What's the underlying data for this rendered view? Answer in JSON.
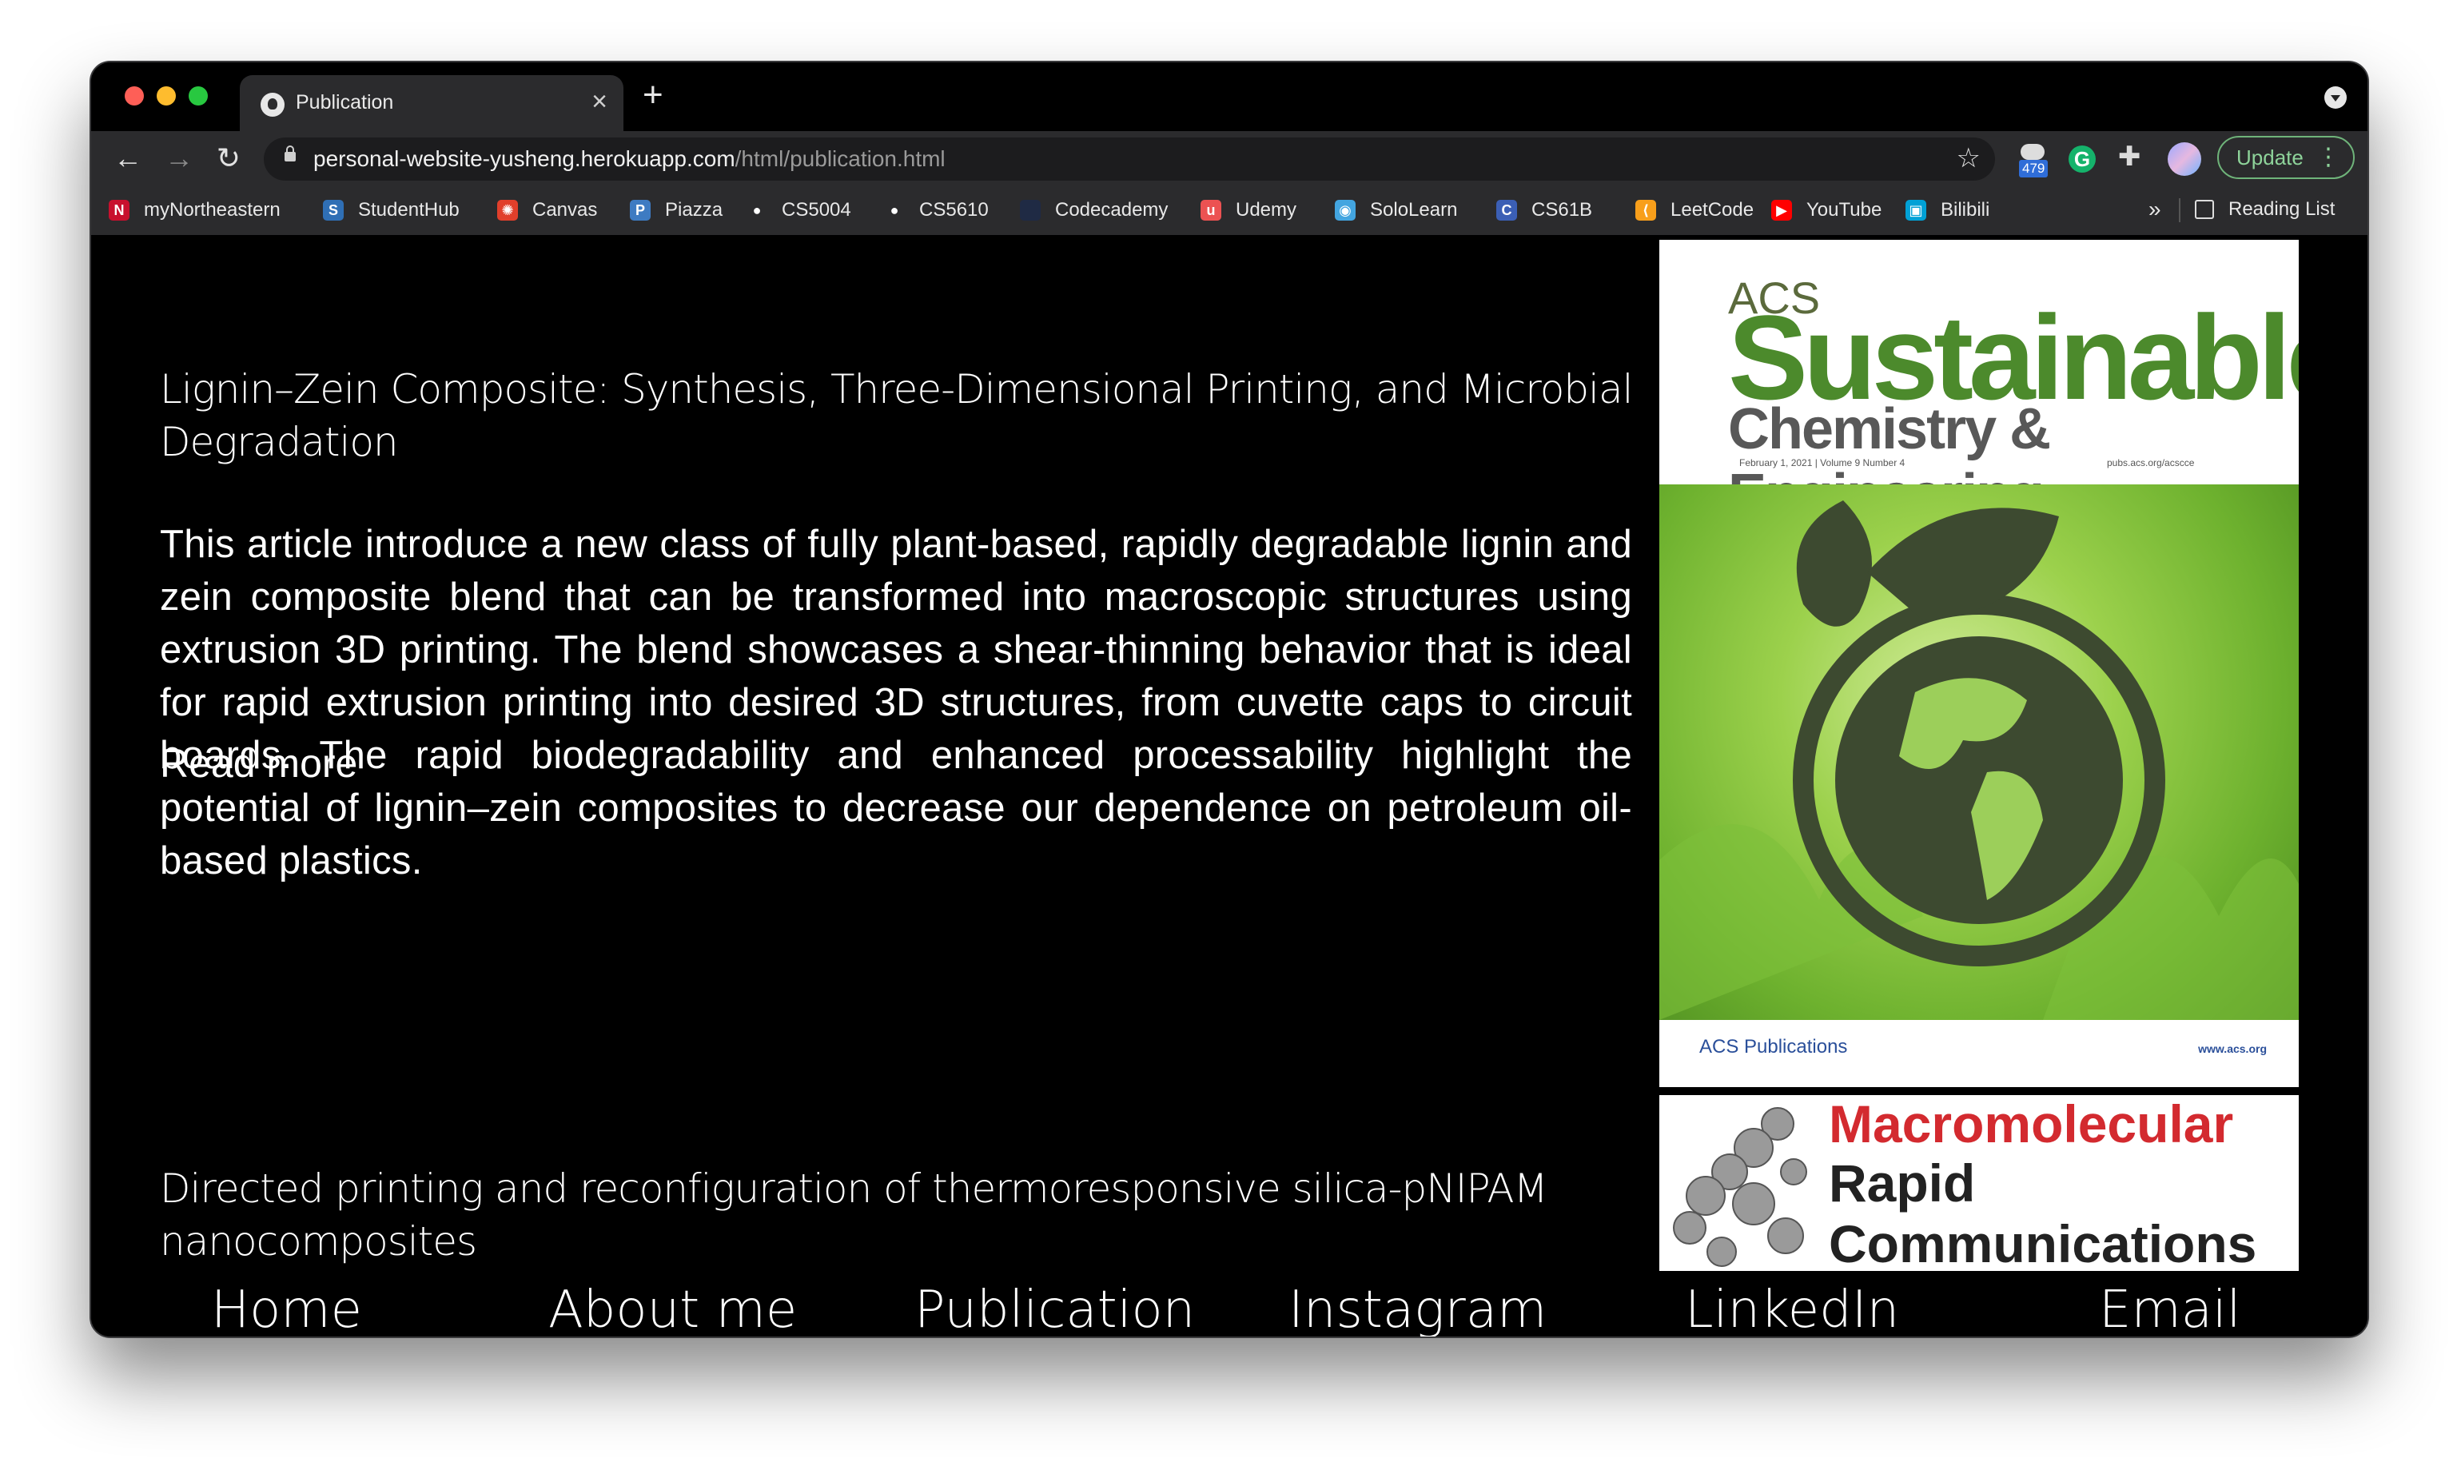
{
  "browser": {
    "tab_title": "Publication",
    "url_host": "personal-website-yusheng.herokuapp.com",
    "url_path": "/html/publication.html",
    "extension_badge": "479",
    "update_label": "Update",
    "bookmarks": [
      {
        "label": "myNortheastern",
        "icon": "northeastern-icon",
        "color": "#c8102e"
      },
      {
        "label": "StudentHub",
        "icon": "studenthub-icon",
        "color": "#2f6fb5"
      },
      {
        "label": "Canvas",
        "icon": "canvas-icon",
        "color": "#e13f2b"
      },
      {
        "label": "Piazza",
        "icon": "piazza-icon",
        "color": "#3e7bc2"
      },
      {
        "label": "CS5004",
        "icon": "github-icon",
        "color": "#ffffff"
      },
      {
        "label": "CS5610",
        "icon": "github-icon",
        "color": "#ffffff"
      },
      {
        "label": "Codecademy",
        "icon": "codecademy-icon",
        "color": "#1f2a44"
      },
      {
        "label": "Udemy",
        "icon": "udemy-icon",
        "color": "#ec5252"
      },
      {
        "label": "SoloLearn",
        "icon": "sololearn-icon",
        "color": "#43a5e0"
      },
      {
        "label": "CS61B",
        "icon": "cs61b-icon",
        "color": "#3b5fb5"
      },
      {
        "label": "LeetCode",
        "icon": "leetcode-icon",
        "color": "#f89f1b"
      },
      {
        "label": "YouTube",
        "icon": "youtube-icon",
        "color": "#ff0000"
      },
      {
        "label": "Bilibili",
        "icon": "bilibili-icon",
        "color": "#00a1d6"
      }
    ],
    "reading_list": "Reading List"
  },
  "publications": [
    {
      "title": "Lignin–Zein Composite: Synthesis, Three-Dimensional Printing, and Microbial Degradation",
      "abstract": "This article introduce a new class of fully plant-based, rapidly degradable lignin and zein composite blend that can be transformed into macroscopic structures using extrusion 3D printing. The blend showcases a shear-thinning behavior that is ideal for rapid extrusion printing into desired 3D structures, from cuvette caps to circuit boards. The rapid biodegradability and enhanced processability highlight the potential of lignin–zein composites to decrease our dependence on petroleum oil-based plastics.",
      "read_more": "Read more",
      "cover": {
        "acs": "ACS",
        "sustainable": "Sustainable",
        "chem_eng": "Chemistry & Engineering",
        "meta": "February 1, 2021 | Volume 9 Number 4",
        "meta_right": "pubs.acs.org/acscce",
        "publisher": "ACS Publications",
        "web": "www.acs.org"
      }
    },
    {
      "title": "Directed printing and reconfiguration of thermoresponsive silica-pNIPAM nanocomposites",
      "cover": {
        "line1": "Macromolecular",
        "line2": "Rapid",
        "line3": "Communications"
      }
    }
  ],
  "nav": [
    "Home",
    "About me",
    "Publication",
    "Instagram",
    "LinkedIn",
    "Email"
  ]
}
